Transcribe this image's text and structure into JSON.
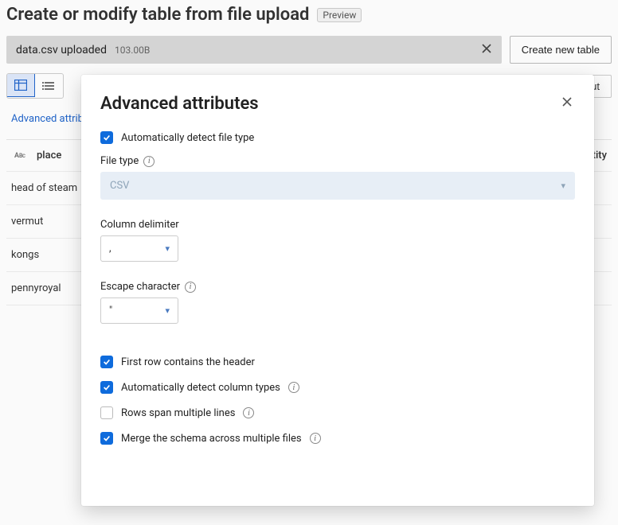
{
  "header": {
    "title": "Create or modify table from file upload",
    "badge": "Preview"
  },
  "upload": {
    "filename": "data.csv uploaded",
    "size": "103.00B",
    "create_button": "Create new table"
  },
  "toolbar": {
    "export_label": "out"
  },
  "advanced_link": "Advanced attribu",
  "table": {
    "col_left_name": "place",
    "col_icon_label": "ABC",
    "col_right_name": "uantity",
    "rows": [
      "head of steam",
      "vermut",
      "kongs",
      "pennyroyal"
    ]
  },
  "modal": {
    "title": "Advanced attributes",
    "auto_detect": {
      "label": "Automatically detect file type",
      "checked": true
    },
    "file_type": {
      "label": "File type",
      "value": "CSV"
    },
    "column_delimiter": {
      "label": "Column delimiter",
      "value": ","
    },
    "escape_char": {
      "label": "Escape character",
      "value": "\""
    },
    "first_row_header": {
      "label": "First row contains the header",
      "checked": true
    },
    "auto_detect_cols": {
      "label": "Automatically detect column types",
      "checked": true
    },
    "rows_span": {
      "label": "Rows span multiple lines",
      "checked": false
    },
    "merge_schema": {
      "label": "Merge the schema across multiple files",
      "checked": true
    }
  }
}
